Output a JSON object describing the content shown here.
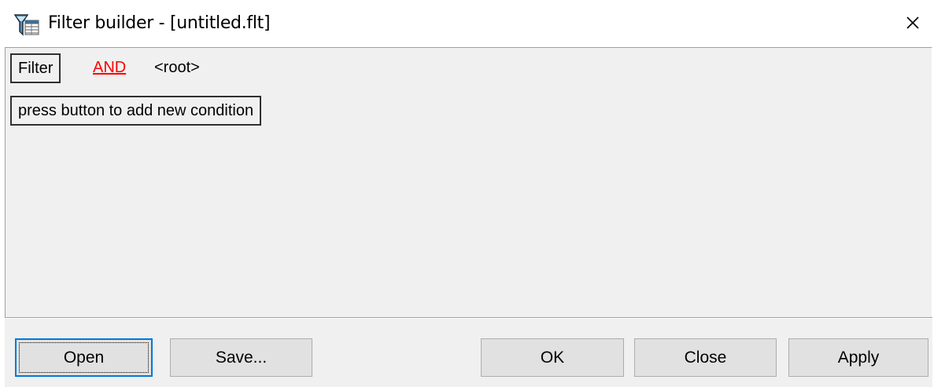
{
  "window": {
    "title": "Filter builder - [untitled.flt]",
    "icon": "filter-funnel-icon",
    "close_icon": "close-icon"
  },
  "tree": {
    "filter_label": "Filter",
    "operator": "AND",
    "operator_color": "#ff0000",
    "root_label": "<root>",
    "add_condition_label": "press button to add new condition"
  },
  "buttons": {
    "open": "Open",
    "save": "Save...",
    "ok": "OK",
    "close": "Close",
    "apply": "Apply"
  },
  "colors": {
    "panel_bg": "#f0f0f0",
    "button_bg": "#e1e1e1",
    "default_button_border": "#0078d7"
  }
}
